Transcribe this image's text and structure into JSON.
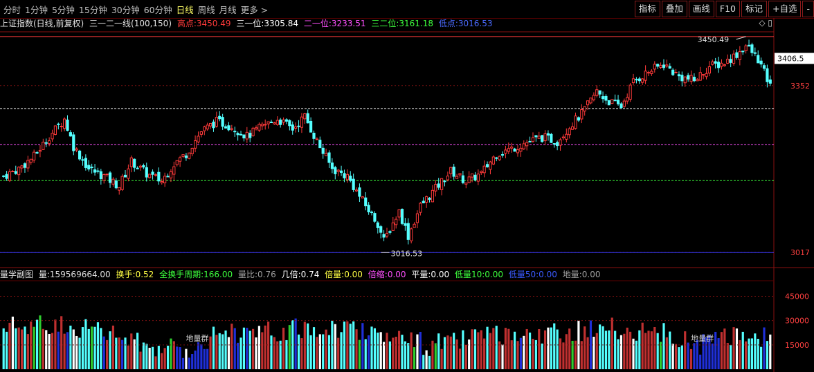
{
  "toolbar": {
    "periods": [
      "分时",
      "1分钟",
      "5分钟",
      "15分钟",
      "30分钟",
      "60分钟",
      "日线",
      "周线",
      "月线",
      "更多 >"
    ],
    "active_period": "日线",
    "buttons": [
      "指标",
      "叠加",
      "画线",
      "F10",
      "标记",
      "+自选",
      "-"
    ]
  },
  "info": {
    "title": "上证指数(日线,前复权)",
    "indicator": "三一二一线(100,150)",
    "high_label": "高点:",
    "high_value": "3450.49",
    "third1_label": "三一位:",
    "third1_value": "3305.84",
    "two1_label": "二一位:",
    "two1_value": "3233.51",
    "three2_label": "三二位:",
    "three2_value": "3161.18",
    "low_label": "低点:",
    "low_value": "3016.53"
  },
  "colors": {
    "up": "#ff3a3a",
    "down": "#54ffff",
    "high": "#ff3a3a",
    "third1": "#ffffff",
    "two1": "#ff50ff",
    "three2": "#3dff3d",
    "low": "#3a3aff",
    "grid": "#7a1010"
  },
  "volume_info": {
    "title": "量学副图",
    "vol_label": "量:",
    "vol_value": "159569664.00",
    "turnover_label": "换手:",
    "turnover_value": "0.52",
    "period_label": "全换手周期:",
    "period_value": "166.00",
    "ratio_label": "量比:",
    "ratio_value": "0.76",
    "times_label": "几倍:",
    "times_value": "0.74",
    "double_label": "倍量:",
    "double_value": "0.00",
    "shrink_label": "倍缩:",
    "shrink_value": "0.00",
    "flat_label": "平量:",
    "flat_value": "0.00",
    "low10_label": "低量10:",
    "low10_value": "0.00",
    "low50_label": "低量50:",
    "low50_value": "0.00",
    "ground_label": "地量:",
    "ground_value": "0.00"
  },
  "chart_data": {
    "type": "candlestick",
    "price_axis": {
      "ylim": [
        3010,
        3460
      ],
      "ticks": [
        3017,
        3352
      ],
      "current": 3406.5,
      "current_label": "3406.5"
    },
    "levels": [
      {
        "name": "高点",
        "value": 3450.49
      },
      {
        "name": "三一位",
        "value": 3305.84
      },
      {
        "name": "二一位",
        "value": 3233.51
      },
      {
        "name": "三二位",
        "value": 3161.18
      },
      {
        "name": "低点",
        "value": 3016.53
      }
    ],
    "annotations": [
      {
        "text": "3450.49",
        "value": 3450.49,
        "bar": 244
      },
      {
        "text": "3016.53",
        "value": 3016.53,
        "bar": 125
      }
    ],
    "volume_axis": {
      "ylim": [
        0,
        55000
      ],
      "ticks": [
        15000,
        30000,
        45000
      ],
      "tick_labels": [
        "15000",
        "30000",
        "45000"
      ]
    },
    "volume_annotations": [
      {
        "text": "地量群",
        "bar": 64
      },
      {
        "text": "地量群",
        "bar": 230
      }
    ],
    "close_anchors": [
      [
        0,
        3170
      ],
      [
        5,
        3185
      ],
      [
        10,
        3210
      ],
      [
        15,
        3250
      ],
      [
        20,
        3285
      ],
      [
        23,
        3230
      ],
      [
        28,
        3185
      ],
      [
        33,
        3170
      ],
      [
        38,
        3150
      ],
      [
        42,
        3200
      ],
      [
        47,
        3175
      ],
      [
        52,
        3160
      ],
      [
        56,
        3195
      ],
      [
        60,
        3215
      ],
      [
        65,
        3260
      ],
      [
        70,
        3280
      ],
      [
        75,
        3270
      ],
      [
        80,
        3250
      ],
      [
        85,
        3270
      ],
      [
        90,
        3285
      ],
      [
        95,
        3265
      ],
      [
        99,
        3290
      ],
      [
        103,
        3240
      ],
      [
        108,
        3185
      ],
      [
        113,
        3170
      ],
      [
        118,
        3120
      ],
      [
        123,
        3075
      ],
      [
        125,
        3040
      ],
      [
        130,
        3100
      ],
      [
        133,
        3050
      ],
      [
        137,
        3110
      ],
      [
        142,
        3145
      ],
      [
        147,
        3180
      ],
      [
        152,
        3160
      ],
      [
        157,
        3175
      ],
      [
        162,
        3215
      ],
      [
        167,
        3225
      ],
      [
        172,
        3238
      ],
      [
        177,
        3248
      ],
      [
        182,
        3240
      ],
      [
        186,
        3270
      ],
      [
        190,
        3295
      ],
      [
        195,
        3340
      ],
      [
        199,
        3320
      ],
      [
        203,
        3310
      ],
      [
        207,
        3360
      ],
      [
        212,
        3380
      ],
      [
        217,
        3395
      ],
      [
        222,
        3370
      ],
      [
        227,
        3362
      ],
      [
        232,
        3390
      ],
      [
        237,
        3398
      ],
      [
        241,
        3415
      ],
      [
        244,
        3432
      ],
      [
        248,
        3405
      ],
      [
        252,
        3350
      ]
    ],
    "volume_profile": [
      [
        0,
        26000
      ],
      [
        20,
        28000
      ],
      [
        35,
        22000
      ],
      [
        45,
        16000
      ],
      [
        55,
        12500
      ],
      [
        62,
        12000
      ],
      [
        70,
        24000
      ],
      [
        85,
        22000
      ],
      [
        95,
        24500
      ],
      [
        110,
        26000
      ],
      [
        125,
        23000
      ],
      [
        130,
        19000
      ],
      [
        140,
        15000
      ],
      [
        150,
        17500
      ],
      [
        160,
        21000
      ],
      [
        170,
        17000
      ],
      [
        180,
        23000
      ],
      [
        190,
        24000
      ],
      [
        200,
        25000
      ],
      [
        210,
        23000
      ],
      [
        220,
        21000
      ],
      [
        230,
        15000
      ],
      [
        240,
        22000
      ],
      [
        252,
        20000
      ]
    ],
    "bar_count": 253
  }
}
